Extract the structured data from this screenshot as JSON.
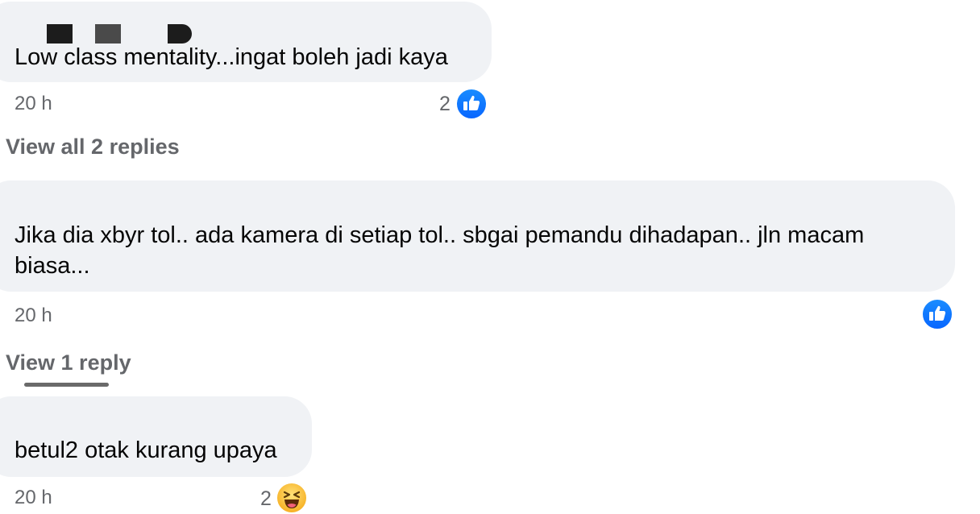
{
  "comments": [
    {
      "text": "Low class mentality...ingat boleh jadi kaya",
      "time": "20 h",
      "reaction_count": "2",
      "reaction_icon": "like-icon",
      "view_replies": "View all 2 replies"
    },
    {
      "text_lines": [
        "Jika dia xbyr tol.. ada kamera di setiap tol.. sbgai pemandu dihadapan.. jln macam",
        "biasa..."
      ],
      "time": "20 h",
      "reaction_count": "",
      "reaction_icon": "like-icon",
      "view_replies": "View 1 reply"
    },
    {
      "text": "betul2 otak kurang upaya",
      "time": "20 h",
      "reaction_count": "2",
      "reaction_icon": "haha-icon"
    }
  ],
  "colors": {
    "bubble": "#f0f2f5",
    "meta_text": "#65676b",
    "like_blue": "#0866ff",
    "haha_yellow": "#f7b125"
  }
}
